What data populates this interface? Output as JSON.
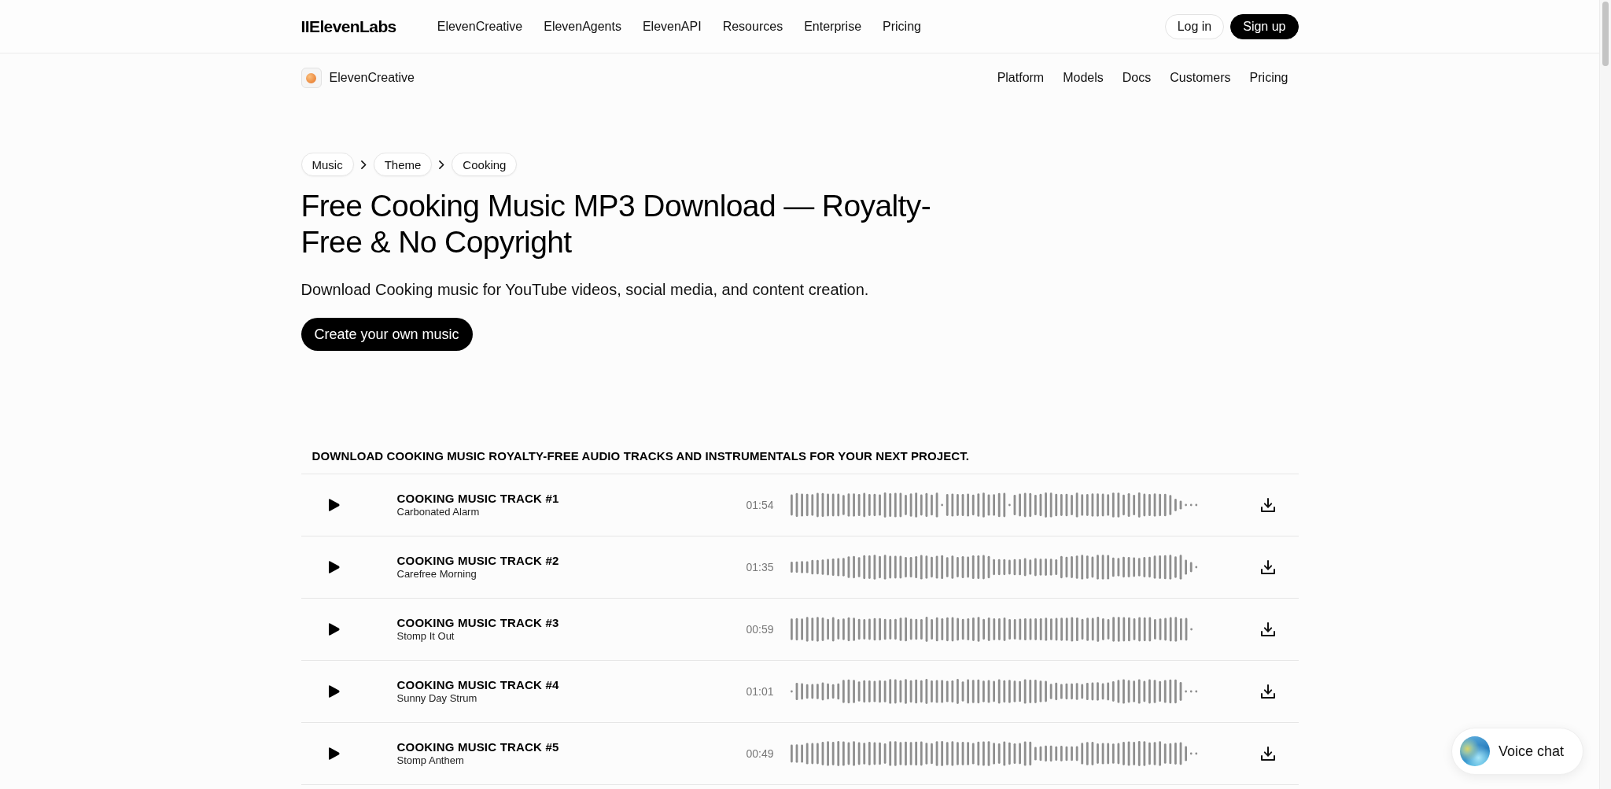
{
  "top_nav": {
    "logo": "IIElevenLabs",
    "links": [
      "ElevenCreative",
      "ElevenAgents",
      "ElevenAPI",
      "Resources",
      "Enterprise",
      "Pricing"
    ],
    "buttons": [
      {
        "label": "Log in",
        "kind": "outline"
      },
      {
        "label": "Sign up",
        "kind": "filled"
      }
    ]
  },
  "sub_nav": {
    "product": "ElevenCreative",
    "links": [
      "Platform",
      "Models",
      "Docs",
      "Customers",
      "Pricing"
    ]
  },
  "breadcrumbs": [
    "Music",
    "Theme",
    "Cooking"
  ],
  "hero": {
    "title": "Free Cooking Music MP3 Download — Royalty-Free & No Copyright",
    "subtitle": "Download Cooking music for YouTube videos, social media, and content creation.",
    "button": "Create your own music"
  },
  "tracks": {
    "heading": "DOWNLOAD COOKING MUSIC ROYALTY-FREE AUDIO TRACKS AND INSTRUMENTALS FOR YOUR NEXT PROJECT.",
    "rows": [
      {
        "title": "COOKING MUSIC TRACK #1",
        "name": "Carbonated Alarm",
        "duration": "01:54"
      },
      {
        "title": "COOKING MUSIC TRACK #2",
        "name": "Carefree Morning",
        "duration": "01:35"
      },
      {
        "title": "COOKING MUSIC TRACK #3",
        "name": "Stomp It Out",
        "duration": "00:59"
      },
      {
        "title": "COOKING MUSIC TRACK #4",
        "name": "Sunny Day Strum",
        "duration": "01:01"
      },
      {
        "title": "COOKING MUSIC TRACK #5",
        "name": "Stomp Anthem",
        "duration": "00:49"
      }
    ]
  },
  "voice_chat": {
    "label": "Voice chat"
  }
}
